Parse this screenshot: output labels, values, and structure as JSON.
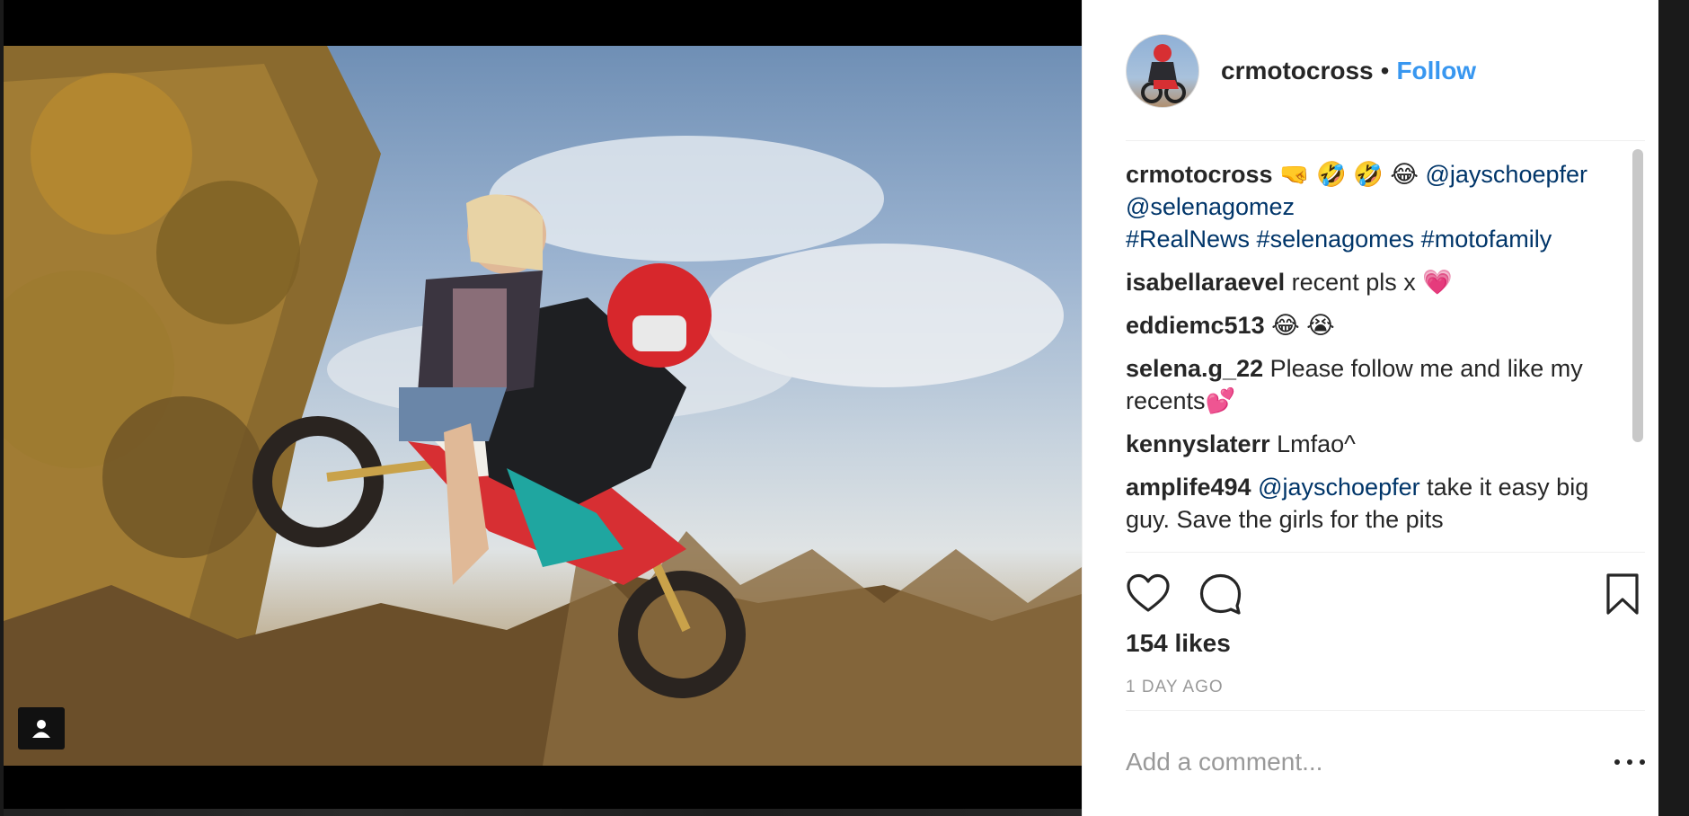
{
  "post": {
    "username": "crmotocross",
    "separator": "•",
    "follow_label": "Follow"
  },
  "caption": {
    "username": "crmotocross",
    "emojis": "🤜 🤣 🤣 😂 ",
    "mention1": "@jayschoepfer",
    "mention2": "@selenagomez",
    "hashtags": "#RealNews #selenagomes #motofamily"
  },
  "comments": [
    {
      "username": "isabellaraevel",
      "text": "recent pls x 💗"
    },
    {
      "username": "eddiemc513",
      "text": "😂 😭"
    },
    {
      "username": "selena.g_22",
      "text": "Please follow me and like my recents💕"
    },
    {
      "username": "kennyslaterr",
      "text": "Lmfao^"
    },
    {
      "username": "amplife494",
      "mention": "@jayschoepfer",
      "text": "take it easy big guy. Save the girls for the pits"
    }
  ],
  "likes_label": "154 likes",
  "timestamp": "1 DAY AGO",
  "comment_input": {
    "placeholder": "Add a comment..."
  },
  "icons": {
    "like": "heart-icon",
    "comment": "speech-bubble-icon",
    "save": "bookmark-icon",
    "more": "more-options-icon",
    "tag": "user-tag-icon"
  },
  "colors": {
    "follow": "#3897f0",
    "link": "#003569",
    "text": "#262626",
    "muted": "#999999"
  }
}
